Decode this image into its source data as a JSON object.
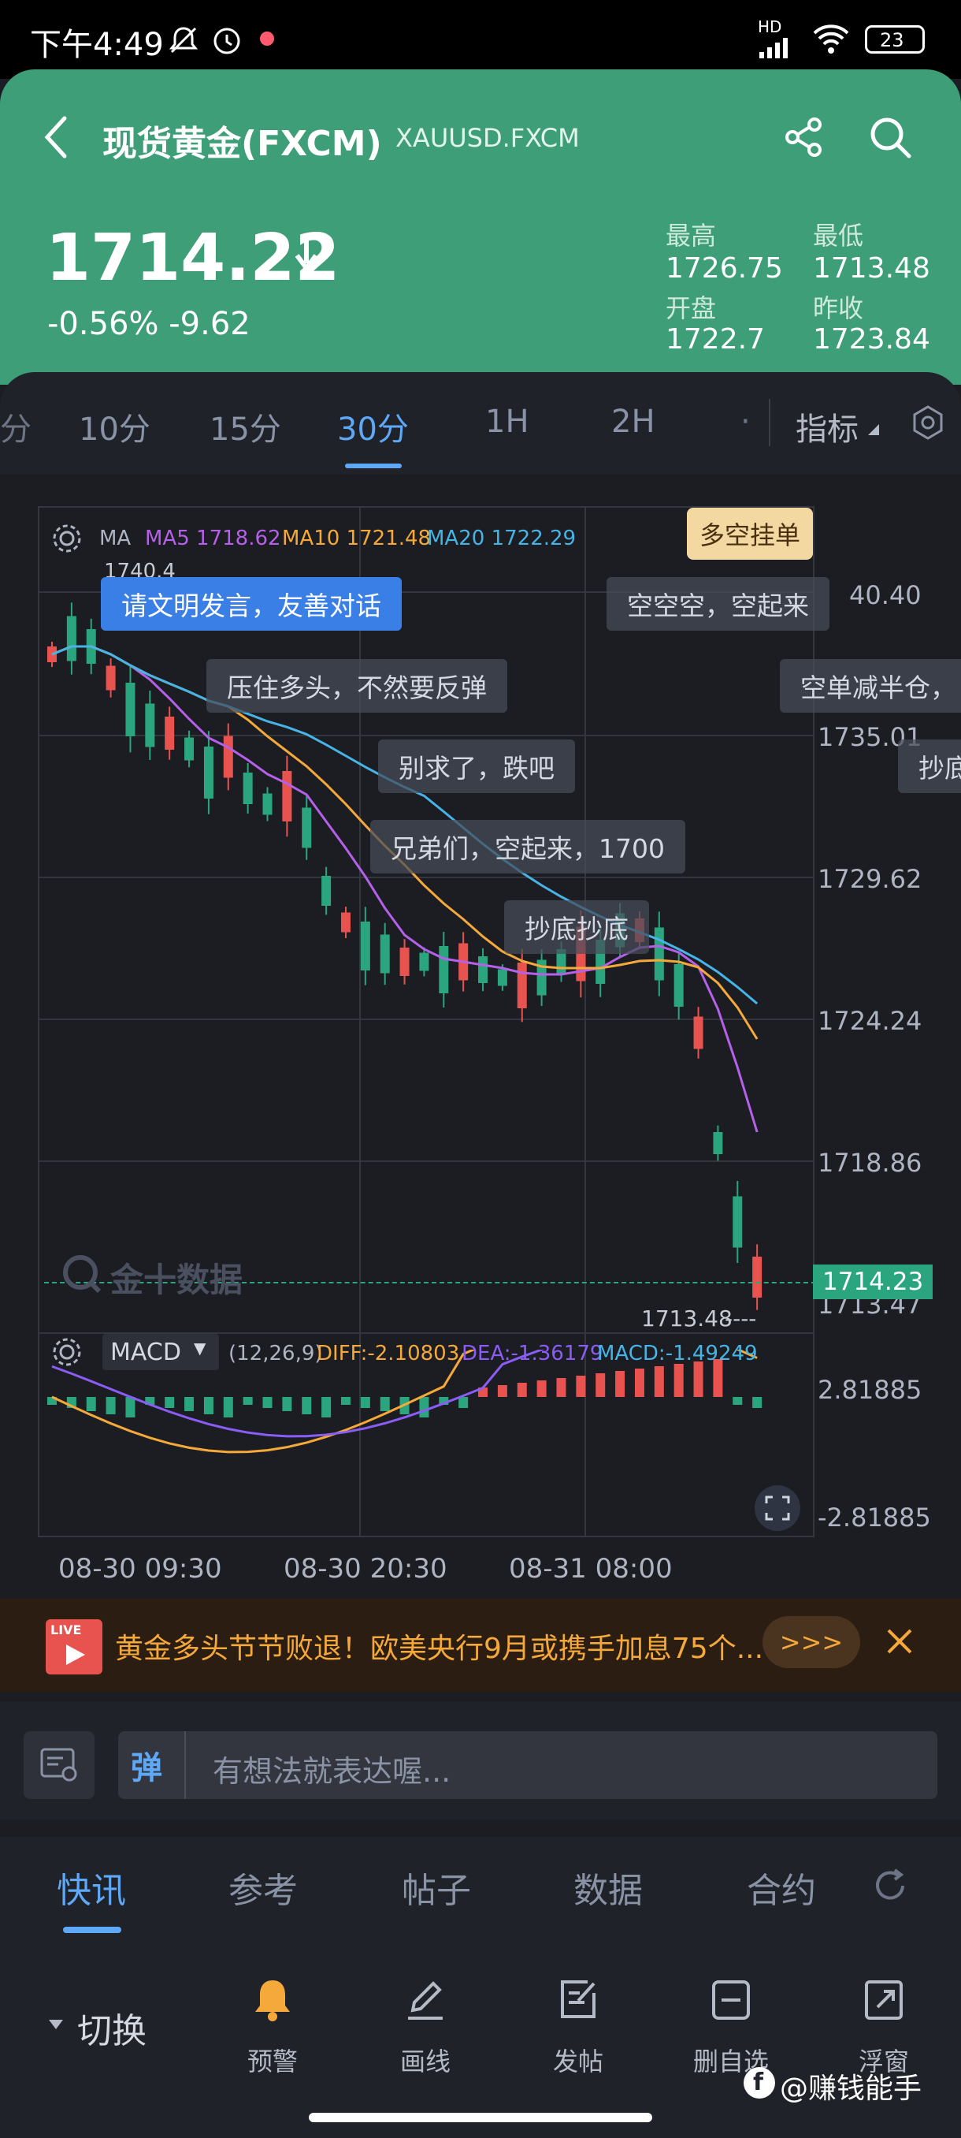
{
  "status": {
    "time": "下午4:49",
    "network": "HD",
    "battery": "23"
  },
  "header": {
    "title": "现货黄金(FXCM)",
    "symbol": "XAUUSD.FXCM",
    "price": "1714.22",
    "change": "-0.56% -9.62",
    "stats": {
      "high_label": "最高",
      "high": "1726.75",
      "low_label": "最低",
      "low": "1713.48",
      "open_label": "开盘",
      "open": "1722.7",
      "prev_label": "昨收",
      "prev": "1723.84"
    }
  },
  "tabs": [
    "10分",
    "15分",
    "30分",
    "1H",
    "2H"
  ],
  "active_tab": "30分",
  "indicator_label": "指标",
  "chart": {
    "ma_label": "MA",
    "ma5": "MA5 1718.62",
    "ma10": "MA10 1721.48",
    "ma20": "MA20 1722.29",
    "order_button": "多空挂单",
    "high_marker": "1740.4",
    "low_marker": "1713.48",
    "current_price": "1714.23",
    "price_axis": [
      "40.40",
      "1735.01",
      "1729.62",
      "1724.24",
      "1718.86",
      "1713.47"
    ],
    "watermark": "金十数据",
    "macd_name": "MACD",
    "macd_params": "(12,26,9)",
    "diff": "DIFF:-2.10803",
    "dea": "DEA:-1.36179",
    "macd_val": "MACD:-1.49249",
    "macd_axis_top": "2.81885",
    "macd_axis_bottom": "-2.81885",
    "time_axis": [
      "08-30 09:30",
      "08-30 20:30",
      "08-31 08:00"
    ],
    "colors": {
      "up": "#e8534f",
      "down": "#2ba57e",
      "ma5": "#b460e8",
      "ma10": "#f5a93a",
      "ma20": "#47b4e6"
    }
  },
  "danmu": [
    "请文明发言，友善对话",
    "空空空，空起来",
    "压住多头，不然要反弹",
    "空单减半仓，",
    "别求了，跌吧",
    "抄底",
    "兄弟们，空起来，1700",
    "抄底抄底"
  ],
  "news": {
    "text": "黄金多头节节败退！欧美央行9月或携手加息75个...",
    "more": ">>>",
    "live_badge": "LIVE"
  },
  "comment": {
    "placeholder": "有想法就表达喔...",
    "badge": "弹"
  },
  "bottom_tabs": [
    "快讯",
    "参考",
    "帖子",
    "数据",
    "合约"
  ],
  "active_bottom_tab": "快讯",
  "toolbar": {
    "switch_label": "切换",
    "items": [
      "预警",
      "画线",
      "发帖",
      "删自选",
      "浮窗"
    ]
  },
  "watermark_user": "@赚钱能手"
}
